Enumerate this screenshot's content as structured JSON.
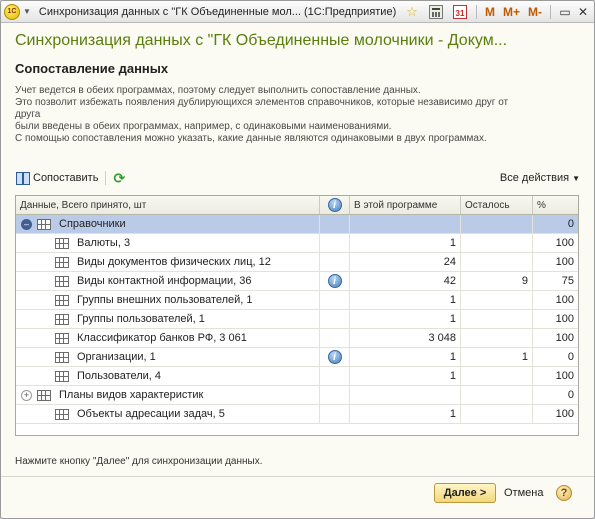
{
  "titlebar": {
    "app_icon_text": "1С",
    "title": "Синхронизация данных с \"ГК Объединенные мол... (1С:Предприятие)",
    "m_label": "M",
    "mplus_label": "M+",
    "mminus_label": "M-",
    "calendar_day": "31"
  },
  "form": {
    "title": "Синхронизация данных с \"ГК Объединенные молочники - Докум...",
    "subtitle": "Сопоставление данных",
    "info_lines": [
      "Учет ведется в обеих программах, поэтому следует выполнить сопоставление данных.",
      "Это позволит избежать появления дублирующихся элементов справочников, которые независимо друг от",
      "друга",
      "были введены в обеих программах, например, с одинаковыми наименованиями.",
      "С помощью сопоставления можно указать, какие данные являются одинаковыми в двух программах."
    ]
  },
  "toolbar": {
    "match_label": "Сопоставить",
    "all_actions_label": "Все действия"
  },
  "table": {
    "headers": {
      "data": "Данные, Всего принято, шт",
      "this_program": "В этой программе",
      "remaining": "Осталось",
      "percent": "%"
    },
    "rows": [
      {
        "name": "Справочники",
        "this": "",
        "remaining": "",
        "percent": "0"
      },
      {
        "name": "Валюты, 3",
        "this": "1",
        "remaining": "",
        "percent": "100"
      },
      {
        "name": "Виды документов физических лиц, 12",
        "this": "24",
        "remaining": "",
        "percent": "100"
      },
      {
        "name": "Виды контактной информации, 36",
        "this": "42",
        "remaining": "9",
        "percent": "75"
      },
      {
        "name": "Группы внешних пользователей, 1",
        "this": "1",
        "remaining": "",
        "percent": "100"
      },
      {
        "name": "Группы пользователей, 1",
        "this": "1",
        "remaining": "",
        "percent": "100"
      },
      {
        "name": "Классификатор банков РФ, 3 061",
        "this": "3 048",
        "remaining": "",
        "percent": "100"
      },
      {
        "name": "Организации, 1",
        "this": "1",
        "remaining": "1",
        "percent": "0"
      },
      {
        "name": "Пользователи, 4",
        "this": "1",
        "remaining": "",
        "percent": "100"
      },
      {
        "name": "Планы видов характеристик",
        "this": "",
        "remaining": "",
        "percent": "0"
      },
      {
        "name": "Объекты адресации задач, 5",
        "this": "1",
        "remaining": "",
        "percent": "100"
      }
    ]
  },
  "footer": {
    "hint": "Нажмите кнопку \"Далее\" для синхронизации данных.",
    "next_label": "Далее >",
    "cancel_label": "Отмена",
    "help_label": "?"
  }
}
